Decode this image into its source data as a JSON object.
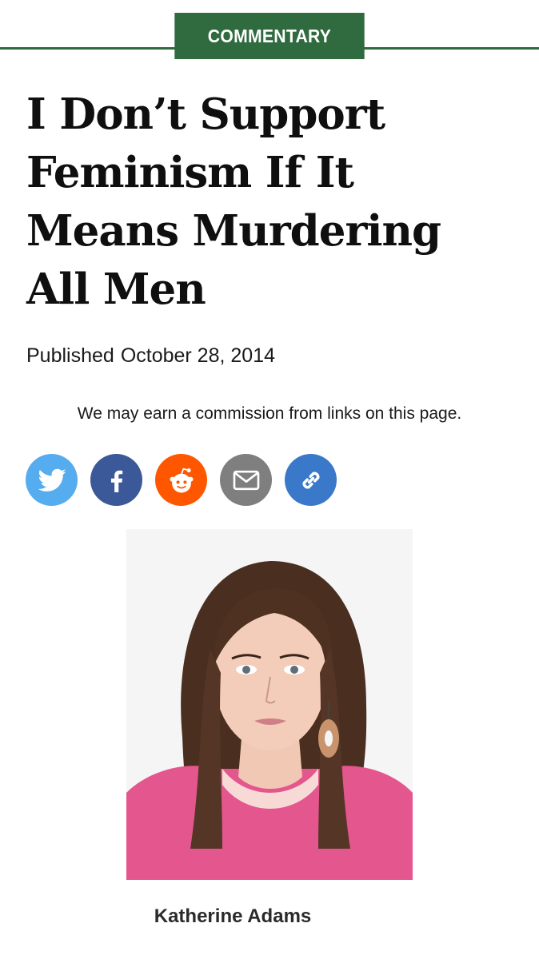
{
  "section": {
    "label": "COMMENTARY"
  },
  "article": {
    "headline_lines": [
      "I Don’t Support",
      "Feminism If It",
      "Means Murdering",
      "All Men"
    ],
    "published_label": "Published",
    "published_date": "October 28, 2014",
    "disclaimer": "We may earn a commission from links on this page.",
    "author_name": "Katherine Adams"
  },
  "share": {
    "buttons": [
      {
        "icon": "twitter-icon",
        "color": "#55acee"
      },
      {
        "icon": "facebook-icon",
        "color": "#3b5998"
      },
      {
        "icon": "reddit-icon",
        "color": "#ff5700"
      },
      {
        "icon": "email-icon",
        "color": "#7f7f7f"
      },
      {
        "icon": "link-icon",
        "color": "#3a78c9"
      }
    ]
  },
  "theme": {
    "accent": "#2f6b3f"
  }
}
